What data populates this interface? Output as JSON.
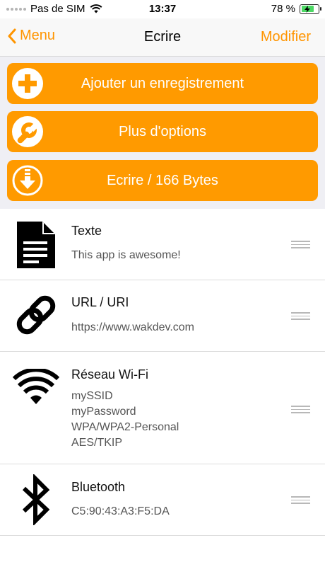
{
  "status_bar": {
    "carrier": "Pas de SIM",
    "time": "13:37",
    "battery": "78 %",
    "battery_level": 0.78
  },
  "nav": {
    "back_label": "Menu",
    "title": "Ecrire",
    "edit_label": "Modifier"
  },
  "actions": {
    "add_label": "Ajouter un enregistrement",
    "options_label": "Plus d'options",
    "write_label": "Ecrire / 166 Bytes"
  },
  "records": [
    {
      "title": "Texte",
      "lines": [
        "This app is awesome!"
      ],
      "icon": "document-icon"
    },
    {
      "title": "URL / URI",
      "lines": [
        "https://www.wakdev.com"
      ],
      "icon": "link-icon"
    },
    {
      "title": "Réseau Wi-Fi",
      "lines": [
        "mySSID",
        "myPassword",
        "WPA/WPA2-Personal",
        "AES/TKIP"
      ],
      "icon": "wifi-icon"
    },
    {
      "title": "Bluetooth",
      "lines": [
        "C5:90:43:A3:F5:DA"
      ],
      "icon": "bluetooth-icon"
    }
  ],
  "colors": {
    "accent": "#ff9500",
    "button": "#ff9a00"
  }
}
